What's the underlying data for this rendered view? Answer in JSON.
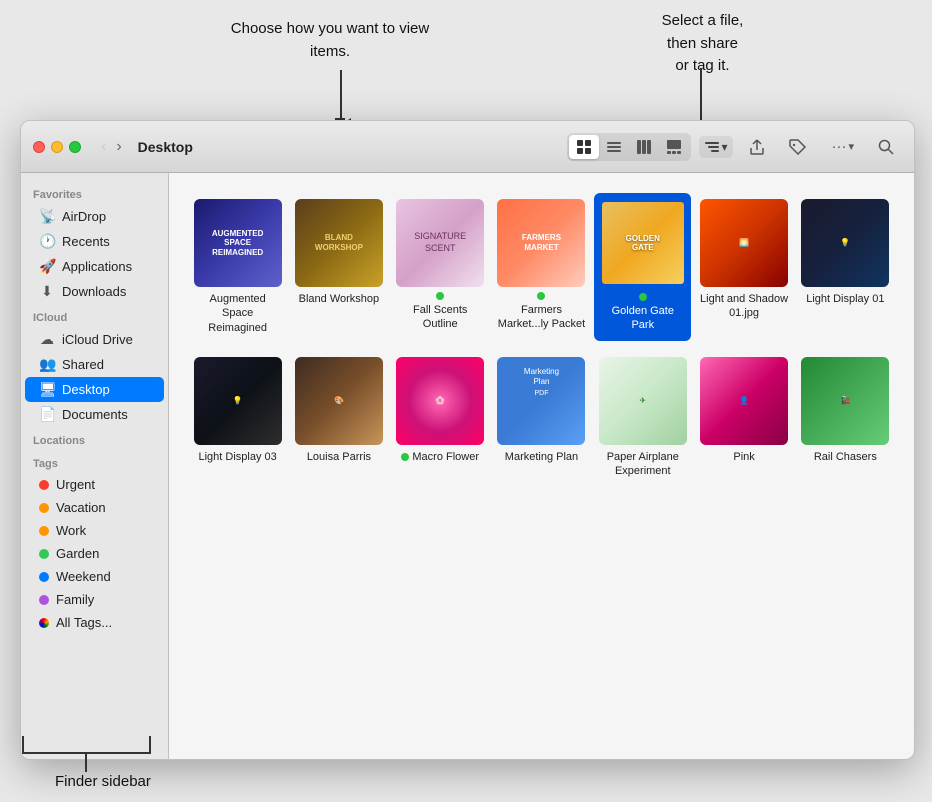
{
  "window": {
    "title": "Desktop"
  },
  "callouts": {
    "view_callout": "Choose how you\nwant to view items.",
    "share_callout": "Select a file,\nthen share\nor tag it.",
    "sidebar_callout": "Finder sidebar"
  },
  "toolbar": {
    "back_label": "‹",
    "forward_label": "›",
    "view_grid_label": "⊞",
    "view_list_label": "☰",
    "view_columns_label": "⊟",
    "view_gallery_label": "⊡",
    "group_label": "Group",
    "share_label": "⬆",
    "tag_label": "🏷",
    "more_label": "···",
    "search_label": "🔍"
  },
  "sidebar": {
    "sections": [
      {
        "label": "Favorites",
        "items": [
          {
            "id": "airdrop",
            "label": "AirDrop",
            "icon": "📡"
          },
          {
            "id": "recents",
            "label": "Recents",
            "icon": "🕐"
          },
          {
            "id": "applications",
            "label": "Applications",
            "icon": "🚀"
          },
          {
            "id": "downloads",
            "label": "Downloads",
            "icon": "⬇"
          }
        ]
      },
      {
        "label": "iCloud",
        "items": [
          {
            "id": "icloud-drive",
            "label": "iCloud Drive",
            "icon": "☁"
          },
          {
            "id": "shared",
            "label": "Shared",
            "icon": "👥"
          },
          {
            "id": "desktop",
            "label": "Desktop",
            "icon": "🖥",
            "active": true
          },
          {
            "id": "documents",
            "label": "Documents",
            "icon": "📄"
          }
        ]
      },
      {
        "label": "Locations",
        "items": []
      },
      {
        "label": "Tags",
        "items": [
          {
            "id": "urgent",
            "label": "Urgent",
            "color": "#ff3b30"
          },
          {
            "id": "vacation",
            "label": "Vacation",
            "color": "#ff9500"
          },
          {
            "id": "work",
            "label": "Work",
            "color": "#ff9500"
          },
          {
            "id": "garden",
            "label": "Garden",
            "color": "#34c759"
          },
          {
            "id": "weekend",
            "label": "Weekend",
            "color": "#007aff"
          },
          {
            "id": "family",
            "label": "Family",
            "color": "#af52de"
          },
          {
            "id": "all-tags",
            "label": "All Tags...",
            "color": "multicolor"
          }
        ]
      }
    ]
  },
  "files": {
    "row1": [
      {
        "id": "augmented",
        "name": "Augmented\nSpace Reimagined",
        "thumb_class": "thumb-augmented",
        "dot": false,
        "selected": false
      },
      {
        "id": "bland",
        "name": "Bland Workshop",
        "thumb_class": "thumb-bland",
        "dot": false,
        "selected": false
      },
      {
        "id": "fall",
        "name": "Fall Scents\nOutline",
        "thumb_class": "thumb-fall",
        "dot": true,
        "selected": false
      },
      {
        "id": "farmers",
        "name": "Farmers\nMarket...ly Packet",
        "thumb_class": "thumb-farmers",
        "dot": true,
        "selected": false
      },
      {
        "id": "golden",
        "name": "Golden Gate\nPark",
        "thumb_class": "thumb-golden",
        "dot": true,
        "selected": true
      },
      {
        "id": "light-shadow",
        "name": "Light and Shadow\n01.jpg",
        "thumb_class": "thumb-light-shadow",
        "dot": false,
        "selected": false
      },
      {
        "id": "light01",
        "name": "Light Display 01",
        "thumb_class": "thumb-light01",
        "dot": false,
        "selected": false
      }
    ],
    "row2": [
      {
        "id": "light03",
        "name": "Light Display 03",
        "thumb_class": "thumb-light03",
        "dot": false,
        "selected": false
      },
      {
        "id": "louisa",
        "name": "Louisa Parris",
        "thumb_class": "thumb-louisa",
        "dot": false,
        "selected": false
      },
      {
        "id": "macro",
        "name": "Macro Flower",
        "thumb_class": "thumb-macro",
        "dot": true,
        "selected": false
      },
      {
        "id": "marketing",
        "name": "Marketing Plan",
        "thumb_class": "thumb-marketing",
        "dot": false,
        "selected": false
      },
      {
        "id": "paper",
        "name": "Paper Airplane\nExperiment",
        "thumb_class": "thumb-paper",
        "dot": false,
        "selected": false
      },
      {
        "id": "pink",
        "name": "Pink",
        "thumb_class": "thumb-pink",
        "dot": false,
        "selected": false
      },
      {
        "id": "rail",
        "name": "Rail Chasers",
        "thumb_class": "thumb-rail",
        "dot": false,
        "selected": false
      }
    ]
  }
}
